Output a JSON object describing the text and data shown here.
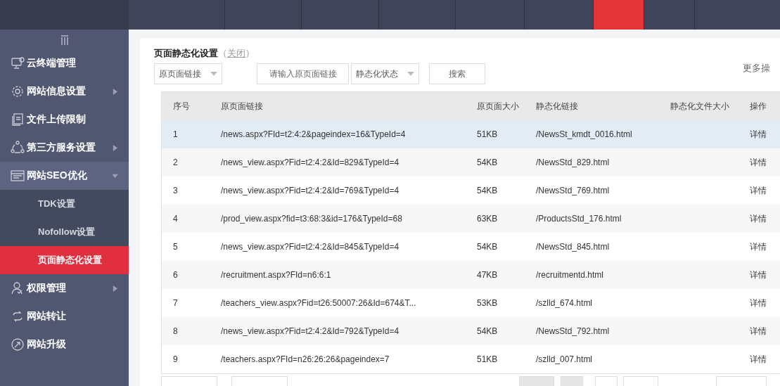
{
  "top_tabs": [
    {
      "selected": false
    },
    {
      "selected": false
    },
    {
      "selected": false
    },
    {
      "selected": false
    },
    {
      "selected": false
    },
    {
      "selected": false
    },
    {
      "selected": true
    },
    {
      "selected": false
    }
  ],
  "sidebar": {
    "items": [
      {
        "label": "云终端管理"
      },
      {
        "label": "网站信息设置",
        "expanded": false
      },
      {
        "label": "文件上传限制"
      },
      {
        "label": "第三方服务设置",
        "expanded": false
      },
      {
        "label": "网站SEO优化",
        "expanded": true,
        "children": [
          {
            "label": "TDK设置",
            "selected": false
          },
          {
            "label": "Nofollow设置",
            "selected": false
          },
          {
            "label": "页面静态化设置",
            "selected": true
          }
        ]
      },
      {
        "label": "权限管理",
        "expanded": false
      },
      {
        "label": "网站转让"
      },
      {
        "label": "网站升级"
      }
    ]
  },
  "panel": {
    "title": "页面静态化设置",
    "close_link": "关闭",
    "paren_open": "（",
    "paren_close": "）",
    "filters": {
      "link_select": "原页面链接",
      "link_input_placeholder": "请输入原页面链接",
      "status_select": "静态化状态",
      "search_button": "搜索"
    },
    "more_actions": "更多操",
    "table": {
      "columns": [
        "序号",
        "原页面链接",
        "原页面大小",
        "静态化链接",
        "静态化文件大小",
        "操作"
      ],
      "rows": [
        {
          "selected": true,
          "cells": [
            "1",
            "/news.aspx?FId=t2:4:2&pageindex=16&TypeId=4",
            "51KB",
            "/NewsSt_kmdt_0016.html",
            "",
            "详情"
          ]
        },
        {
          "selected": false,
          "cells": [
            "2",
            "/news_view.aspx?Fid=t2:4:2&Id=829&TypeId=4",
            "54KB",
            "/NewsStd_829.html",
            "",
            "详情"
          ]
        },
        {
          "selected": false,
          "cells": [
            "3",
            "/news_view.aspx?Fid=t2:4:2&Id=769&TypeId=4",
            "54KB",
            "/NewsStd_769.html",
            "",
            "详情"
          ]
        },
        {
          "selected": false,
          "cells": [
            "4",
            "/prod_view.aspx?fid=t3:68:3&id=176&TypeId=68",
            "63KB",
            "/ProductsStd_176.html",
            "",
            "详情"
          ]
        },
        {
          "selected": false,
          "cells": [
            "5",
            "/news_view.aspx?Fid=t2:4:2&Id=845&TypeId=4",
            "54KB",
            "/NewsStd_845.html",
            "",
            "详情"
          ]
        },
        {
          "selected": false,
          "cells": [
            "6",
            "/recruitment.aspx?FId=n6:6:1",
            "47KB",
            "/recruitmentd.html",
            "",
            "详情"
          ]
        },
        {
          "selected": false,
          "cells": [
            "7",
            "/teachers_view.aspx?Fid=t26:50007:26&Id=674&T...",
            "53KB",
            "/szlld_674.html",
            "",
            "详情"
          ]
        },
        {
          "selected": false,
          "cells": [
            "8",
            "/news_view.aspx?Fid=t2:4:2&Id=792&TypeId=4",
            "54KB",
            "/NewsStd_792.html",
            "",
            "详情"
          ]
        },
        {
          "selected": false,
          "cells": [
            "9",
            "/teachers.aspx?FId=n26:26:26&pageindex=7",
            "51KB",
            "/szlld_007.html",
            "",
            "详情"
          ]
        }
      ]
    }
  }
}
